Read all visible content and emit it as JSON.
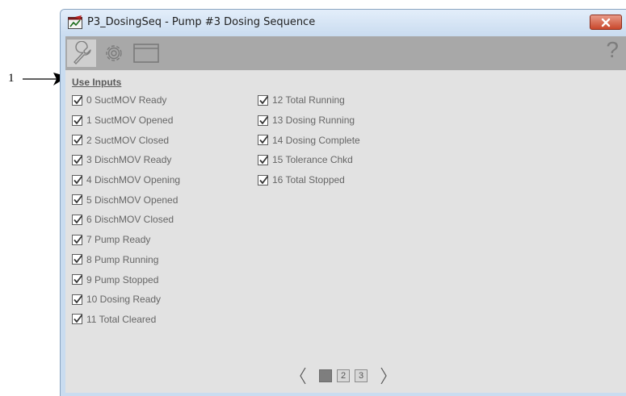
{
  "callout": {
    "number": "1"
  },
  "window": {
    "title": "P3_DosingSeq - Pump #3 Dosing Sequence",
    "close_icon": "close-x-icon"
  },
  "toolbar": {
    "tabs": [
      {
        "icon": "wrench-icon"
      },
      {
        "icon": "gear-icon"
      },
      {
        "icon": "window-icon"
      }
    ],
    "help_label": "?"
  },
  "section": {
    "title": "Use Inputs"
  },
  "inputs_left": [
    {
      "label": "0 SuctMOV Ready",
      "checked": true
    },
    {
      "label": "1 SuctMOV Opened",
      "checked": true
    },
    {
      "label": "2 SuctMOV Closed",
      "checked": true
    },
    {
      "label": "3 DischMOV Ready",
      "checked": true
    },
    {
      "label": "4 DischMOV Opening",
      "checked": true
    },
    {
      "label": "5 DischMOV Opened",
      "checked": true
    },
    {
      "label": "6 DischMOV Closed",
      "checked": true
    },
    {
      "label": "7 Pump Ready",
      "checked": true
    },
    {
      "label": "8 Pump Running",
      "checked": true
    },
    {
      "label": "9 Pump Stopped",
      "checked": true
    },
    {
      "label": "10 Dosing Ready",
      "checked": true
    },
    {
      "label": "11 Total Cleared",
      "checked": true
    }
  ],
  "inputs_right": [
    {
      "label": "12 Total Running",
      "checked": true
    },
    {
      "label": "13 Dosing Running",
      "checked": true
    },
    {
      "label": "14 Dosing Complete",
      "checked": true
    },
    {
      "label": "15 Tolerance Chkd",
      "checked": true
    },
    {
      "label": "16 Total Stopped",
      "checked": true
    }
  ],
  "pager": {
    "prev_label": "〈",
    "next_label": "〉",
    "pages": [
      "1",
      "2",
      "3"
    ],
    "current_page": "1"
  }
}
